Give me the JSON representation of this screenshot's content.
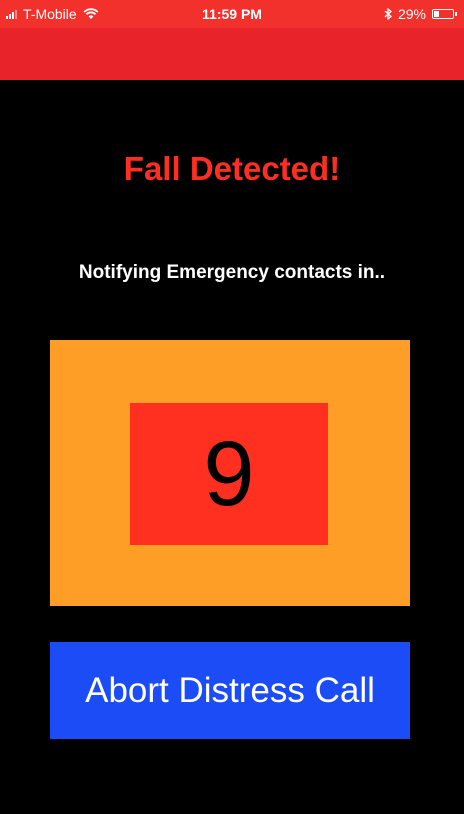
{
  "status_bar": {
    "carrier": "T-Mobile",
    "time": "11:59 PM",
    "battery_percent": "29%",
    "battery_level": 0.29,
    "icons": [
      "signal-icon",
      "wifi-icon",
      "bluetooth-icon",
      "battery-icon"
    ]
  },
  "alert": {
    "title": "Fall Detected!",
    "subtitle": "Notifying Emergency contacts in..",
    "countdown": "9"
  },
  "actions": {
    "abort_label": "Abort Distress Call"
  },
  "colors": {
    "status_bar": "#f2312c",
    "nav_bar": "#e8232a",
    "title": "#ff2e22",
    "countdown_panel": "#ff9e26",
    "countdown_box": "#ff3020",
    "abort_button": "#1b4cf6",
    "background": "#000000"
  }
}
